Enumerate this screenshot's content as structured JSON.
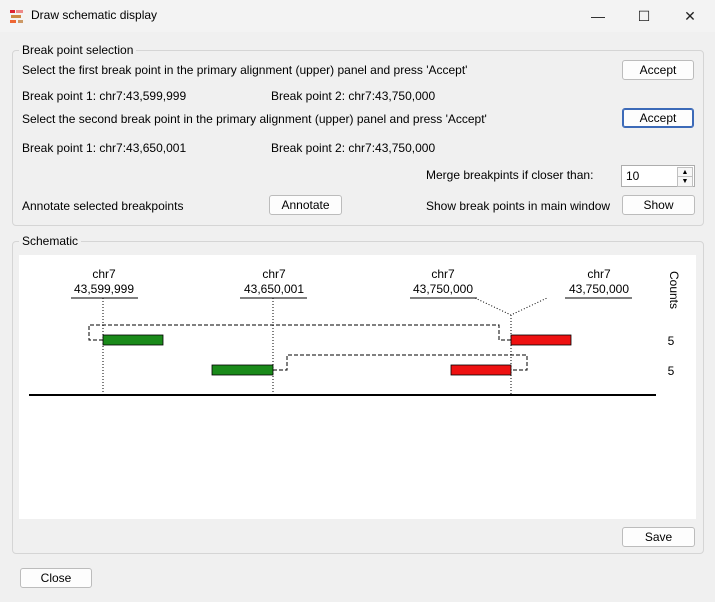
{
  "window": {
    "title": "Draw schematic display",
    "min_glyph": "—",
    "max_glyph": "☐",
    "close_glyph": "✕"
  },
  "breakpoint_group": {
    "label": "Break point selection",
    "instr1": "Select the first break point in the primary alignment (upper) panel and press 'Accept'",
    "accept1": "Accept",
    "row1_bp1": "Break point 1: chr7:43,599,999",
    "row1_bp2": "Break point 2: chr7:43,750,000",
    "instr2": "Select the second break point in the primary alignment (upper) panel and press 'Accept'",
    "accept2": "Accept",
    "row2_bp1": "Break point 1: chr7:43,650,001",
    "row2_bp2": "Break point 2: chr7:43,750,000",
    "merge_label": "Merge breakpints if closer than:",
    "merge_value": "10",
    "annotate_label": "Annotate selected breakpoints",
    "annotate_button": "Annotate",
    "show_label": "Show break points in main window",
    "show_button": "Show"
  },
  "schematic_group": {
    "label": "Schematic",
    "counts_label": "Counts",
    "breakpoints": [
      {
        "chrom": "chr7",
        "pos": "43,599,999"
      },
      {
        "chrom": "chr7",
        "pos": "43,650,001"
      },
      {
        "chrom": "chr7",
        "pos": "43,750,000"
      },
      {
        "chrom": "chr7",
        "pos": "43,750,000"
      }
    ],
    "count_values": [
      "5",
      "5"
    ],
    "colors": {
      "left_segment": "#1a8a1a",
      "right_segment": "#ee1111"
    },
    "save_button": "Save"
  },
  "footer": {
    "close_button": "Close"
  }
}
